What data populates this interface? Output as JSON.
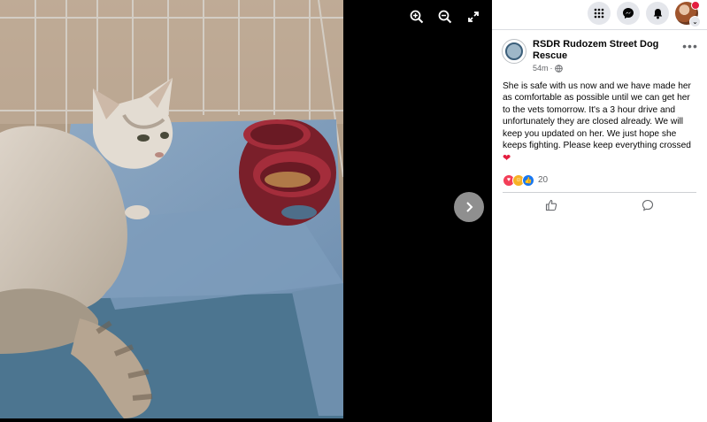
{
  "viewer": {
    "photo_alt": "cat in a crate",
    "tools": [
      {
        "name": "zoom-in-icon"
      },
      {
        "name": "zoom-out-icon"
      },
      {
        "name": "fullscreen-icon"
      }
    ],
    "next_icon": "chevron-right-icon"
  },
  "topbar": {
    "icons": [
      "menu-grid-icon",
      "messenger-icon",
      "notifications-icon"
    ],
    "account_chevron": "⌄"
  },
  "post": {
    "page_name": "RSDR Rudozem Street Dog Rescue",
    "time": "54m",
    "separator": "·",
    "more_label": "•••",
    "text": "She is safe with us now and we have made her as comfortable as possible until we can get her to the vets tomorrow. It's a 3 hour drive and unfortunately they are closed already. We will keep you updated on her. We just hope she keeps fighting. Please keep everything crossed",
    "heart": "❤",
    "reaction_count": "20",
    "reactions": [
      "love",
      "care",
      "like"
    ]
  },
  "colors": {
    "like_blue": "#1877f2",
    "love_red": "#f33e58",
    "care_yellow": "#f7b125"
  }
}
